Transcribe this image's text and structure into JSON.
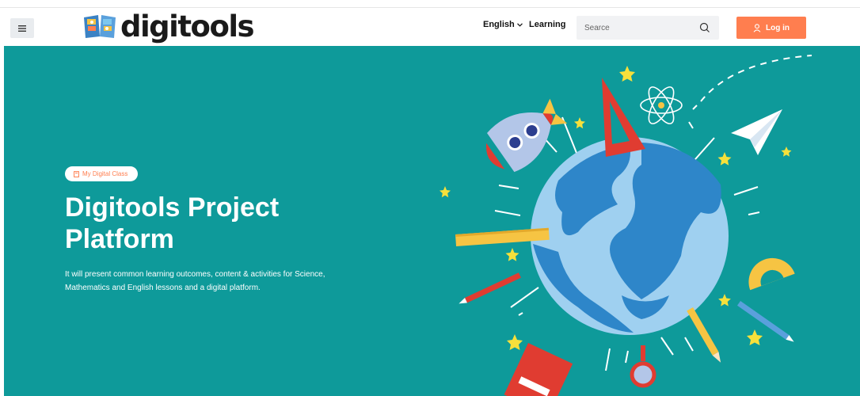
{
  "header": {
    "logo_text": "digitools",
    "nav": {
      "language_label": "English",
      "learning_label": "Learning"
    },
    "search": {
      "placeholder": "Searce"
    },
    "login_label": "Log in"
  },
  "hero": {
    "badge_label": "My Digital Class",
    "title_line1": "Digitools Project",
    "title_line2": "Platform",
    "description_line1": "It will present common learning outcomes, content & activities for Science,",
    "description_line2": "Mathematics and English lessons and a digital platform."
  },
  "colors": {
    "accent": "#ff7e4f",
    "hero_bg": "#0e9a9a",
    "logo_blue": "#3b82c4"
  },
  "icons": [
    "menu-icon",
    "book-logo-icon",
    "chevron-down-icon",
    "search-icon",
    "user-icon",
    "bookmark-icon"
  ]
}
